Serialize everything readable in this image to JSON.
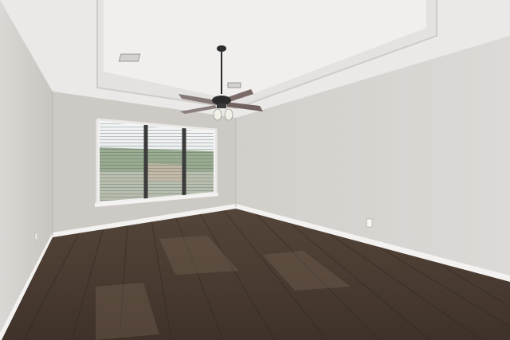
{
  "scene": {
    "subject": "empty-room",
    "features": [
      "tray-ceiling",
      "ceiling-fan",
      "triple-window-with-blinds",
      "dark-wood-floor",
      "baseboards",
      "ceiling-vent",
      "wall-outlet"
    ]
  },
  "colors": {
    "ceiling": "#ecebea",
    "tray_inner": "#f1f0ef",
    "left_wall": "#d0cdca",
    "back_wall": "#cfcbc7",
    "right_wall": "#d7d4d1",
    "floor": "#4a3c31",
    "floor_light": "#6b5a4c",
    "baseboard": "#f3f2f0",
    "window_sky": "#e8ecee",
    "trees": "#6f8a66",
    "fan_metal": "#2d2d2d"
  }
}
